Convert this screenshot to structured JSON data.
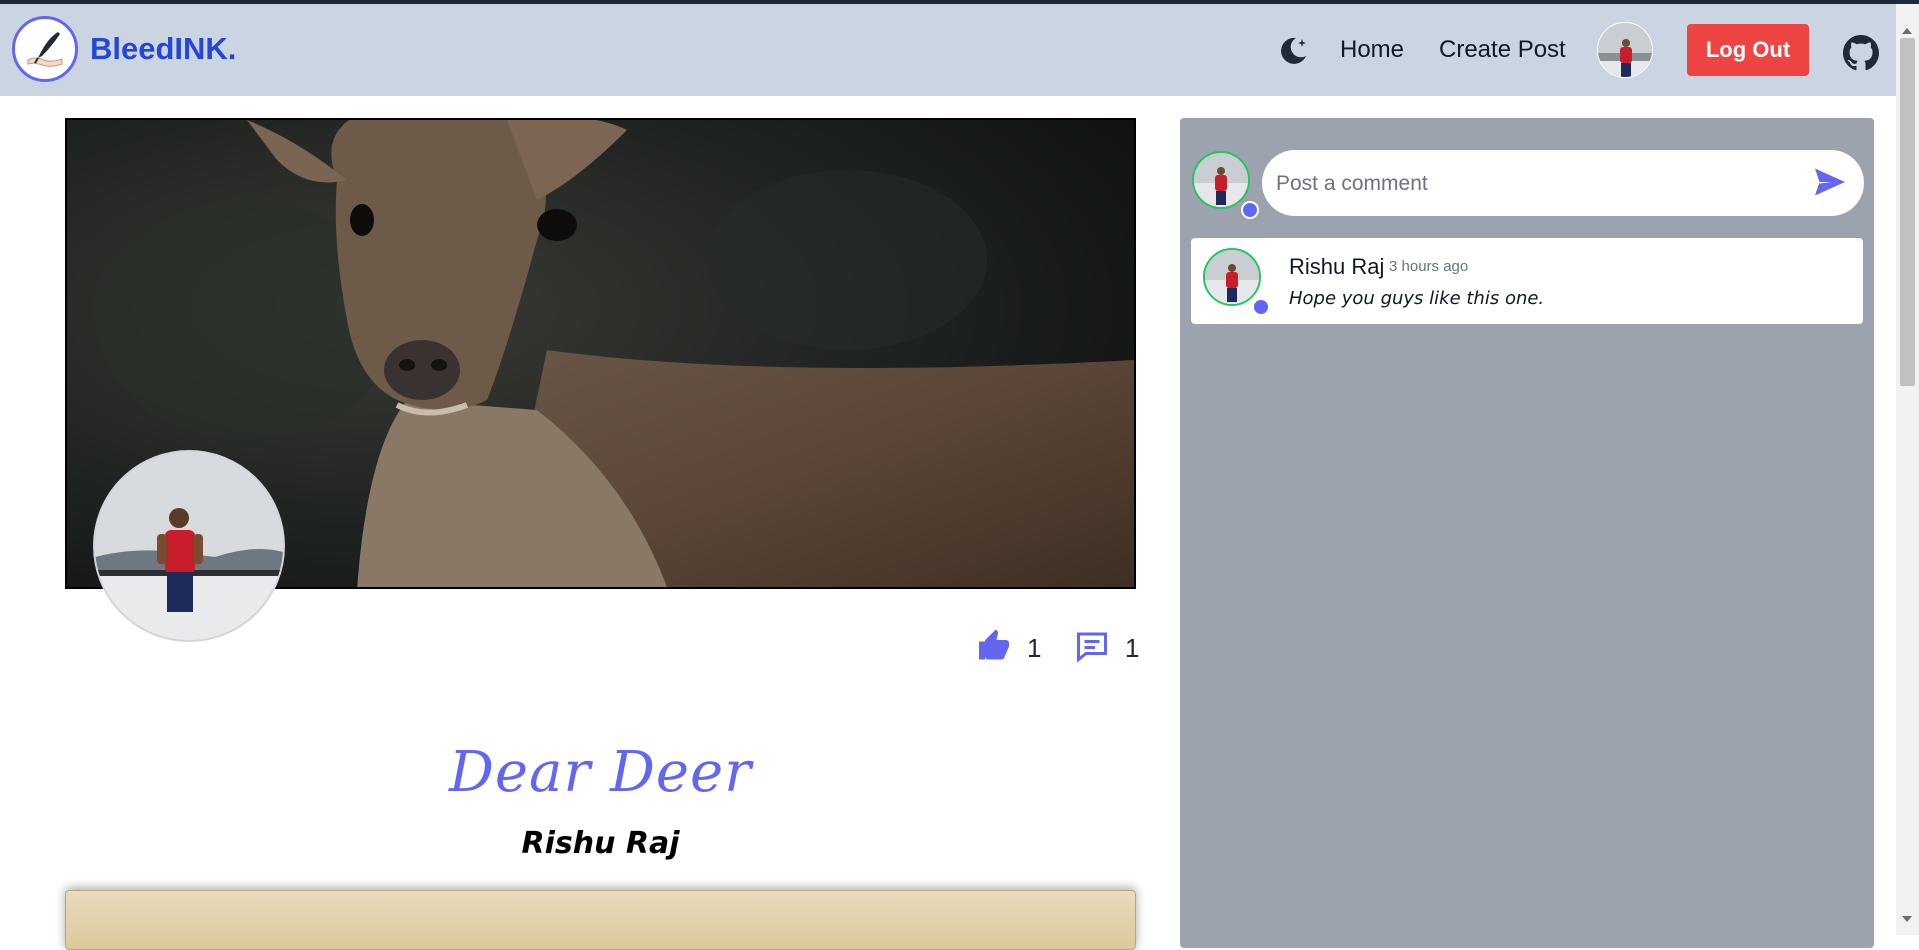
{
  "navbar": {
    "brand": "BleedINK.",
    "home_label": "Home",
    "create_post_label": "Create Post",
    "logout_label": "Log Out",
    "theme_icon": "moon-icon",
    "repo_icon": "github-icon"
  },
  "post": {
    "title": "Dear Deer",
    "author": "Rishu Raj",
    "likes": "1",
    "comments": "1"
  },
  "comments_panel": {
    "input_placeholder": "Post a comment",
    "comments": [
      {
        "author": "Rishu Raj",
        "time": "3 hours ago",
        "text": "Hope you guys like this one."
      }
    ]
  },
  "colors": {
    "accent": "#6366f1",
    "brand": "#2546d6",
    "navbar_bg": "#cbd5e1",
    "logout_bg": "#ef4444",
    "panel_bg": "#9ca3af",
    "avatar_ring": "#22c55e"
  }
}
